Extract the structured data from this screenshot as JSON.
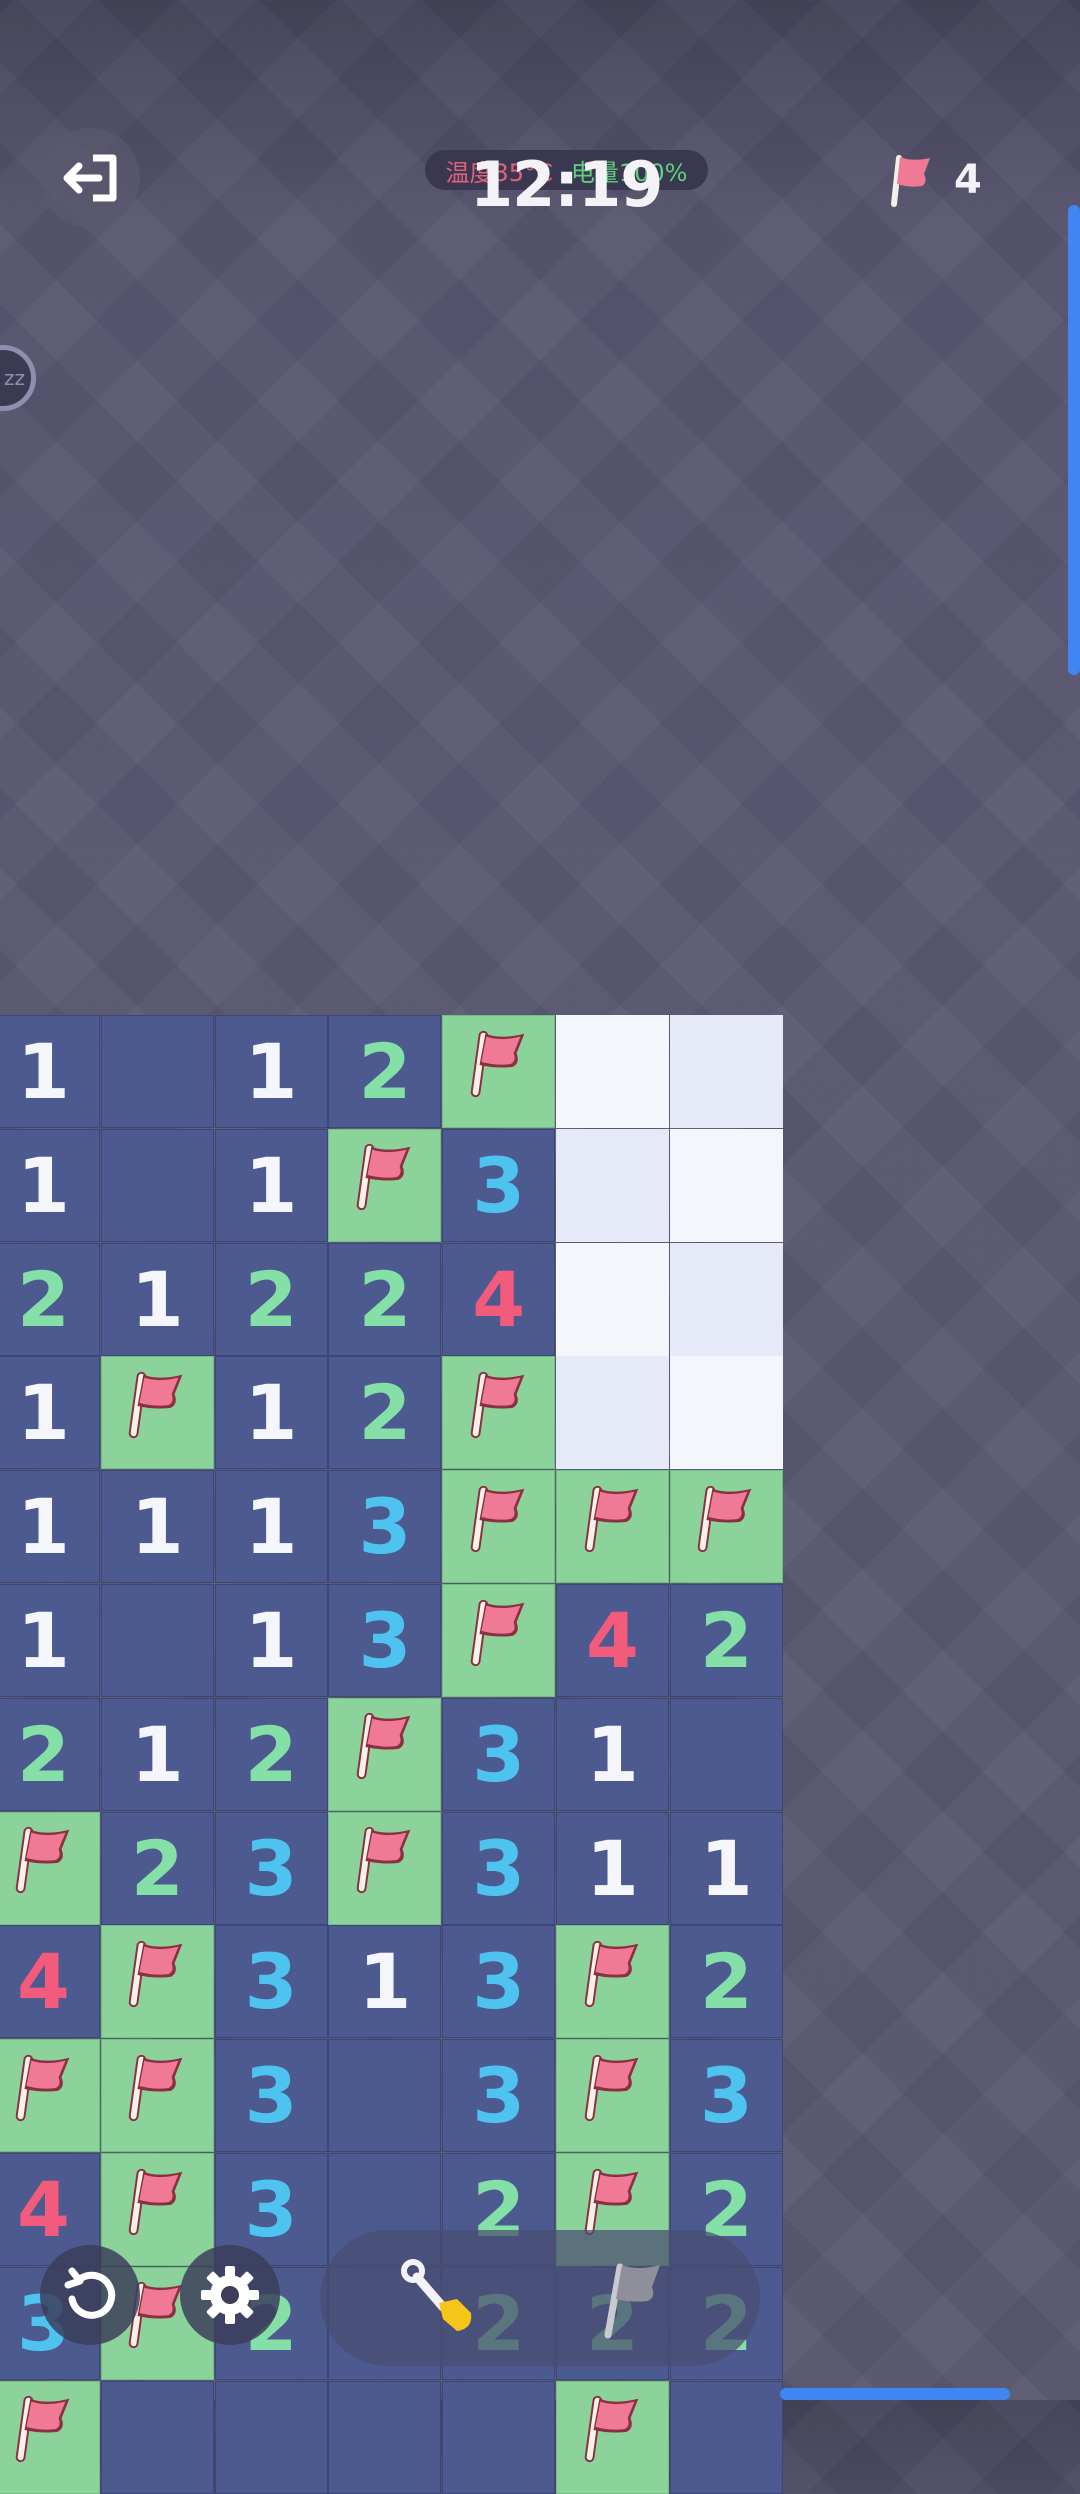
{
  "header": {
    "clock": "12:19",
    "temperature": "温度35°C",
    "battery": "电量100%",
    "flags_remaining": "4"
  },
  "zoom_badge": "zz",
  "board": {
    "rows": [
      [
        "1",
        "",
        "1",
        "2",
        "F",
        "H1",
        "H2"
      ],
      [
        "1",
        "",
        "1",
        "F",
        "3",
        "H2",
        "H1"
      ],
      [
        "2",
        "1",
        "2",
        "2",
        "4",
        "H1",
        "H2"
      ],
      [
        "1",
        "F",
        "1",
        "2",
        "F",
        "H2",
        "H1"
      ],
      [
        "1",
        "1",
        "1",
        "3",
        "F",
        "F",
        "F"
      ],
      [
        "1",
        "",
        "1",
        "3",
        "F",
        "4",
        "2"
      ],
      [
        "2",
        "1",
        "2",
        "F",
        "3",
        "1",
        ""
      ],
      [
        "F",
        "2",
        "3",
        "F",
        "3",
        "1",
        "1"
      ],
      [
        "4",
        "F",
        "3",
        "1",
        "3",
        "F",
        "2"
      ],
      [
        "F",
        "F",
        "3",
        "",
        "3",
        "F",
        "3"
      ],
      [
        "4",
        "F",
        "3",
        "",
        "2",
        "F",
        "2"
      ],
      [
        "3",
        "F",
        "2",
        "",
        "2",
        "2",
        "2"
      ],
      [
        "F",
        "",
        "",
        "",
        "",
        "F",
        ""
      ]
    ]
  },
  "controls": {
    "restart": "restart-icon",
    "settings": "gear-icon",
    "dig_tool": "shovel-icon",
    "flag_tool": "flag-icon"
  },
  "colors": {
    "open_cell": "#4c5a8f",
    "flag_cell": "#8bd39a",
    "num1": "#f4f6fb",
    "num2": "#84e0a7",
    "num3": "#4ec3f0",
    "num4": "#f25b7c",
    "accent": "#3f86f2"
  }
}
